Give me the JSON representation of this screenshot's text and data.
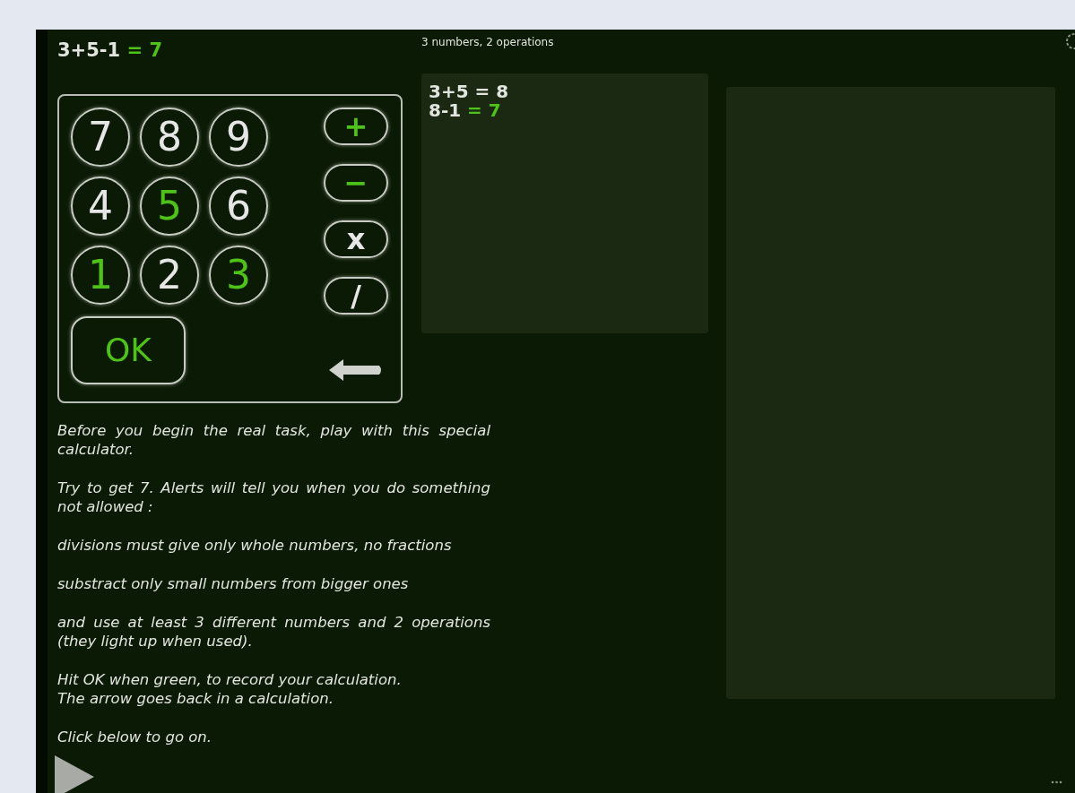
{
  "header": {
    "expression": "3+5-1",
    "result": "= 7",
    "correct": true
  },
  "keypad": {
    "digits": [
      {
        "label": "7",
        "used": false
      },
      {
        "label": "8",
        "used": false
      },
      {
        "label": "9",
        "used": false
      },
      {
        "label": "4",
        "used": false
      },
      {
        "label": "5",
        "used": true
      },
      {
        "label": "6",
        "used": false
      },
      {
        "label": "1",
        "used": true
      },
      {
        "label": "2",
        "used": false
      },
      {
        "label": "3",
        "used": true
      }
    ],
    "operators": [
      {
        "label": "+",
        "used": true
      },
      {
        "label": "−",
        "used": true
      },
      {
        "label": "x",
        "used": false
      },
      {
        "label": "/",
        "used": false
      }
    ],
    "ok": {
      "label": "OK",
      "lit": true
    }
  },
  "counter": "3 numbers, 2 operations",
  "steps": [
    {
      "expression": "3+5",
      "result": "= 8",
      "correct": false
    },
    {
      "expression": "8-1",
      "result": "= 7",
      "correct": true
    }
  ],
  "instructions": [
    "Before you begin the real task, play with this special calculator.",
    "Try to get 7. Alerts will tell you when you do something not allowed :",
    "divisions must give only whole numbers, no fractions",
    "substract only small numbers from bigger ones",
    "and use at least 3 different numbers and 2 operations (they light up when used).",
    "Hit OK when green, to record your calculation.\nThe arrow goes back in a calculation.",
    "Click below to go on."
  ]
}
